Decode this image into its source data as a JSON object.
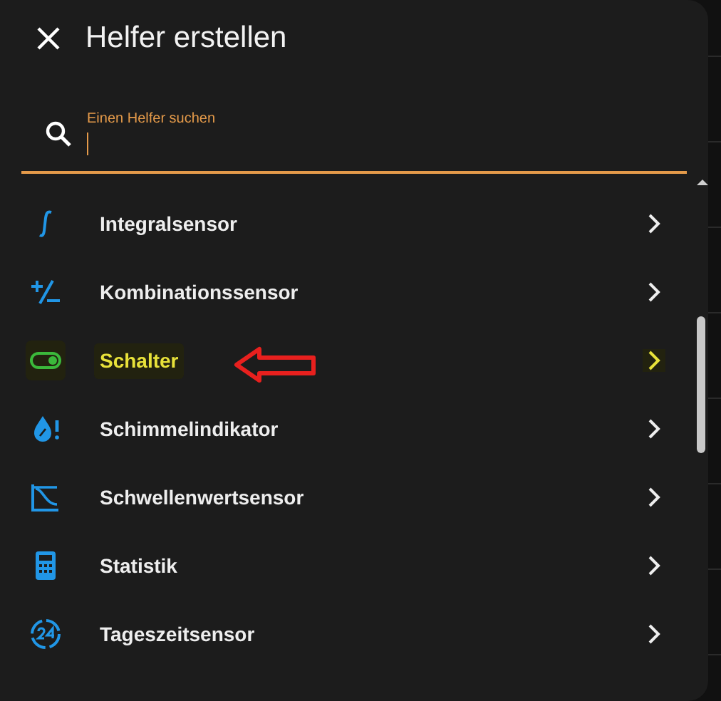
{
  "dialog": {
    "title": "Helfer erstellen",
    "search": {
      "label": "Einen Helfer suchen",
      "focused": true
    },
    "items": [
      {
        "kind": "integral",
        "label": "Integralsensor",
        "highlighted": false
      },
      {
        "kind": "plusminus",
        "label": "Kombinationssensor",
        "highlighted": false
      },
      {
        "kind": "toggle",
        "label": "Schalter",
        "highlighted": true
      },
      {
        "kind": "mold",
        "label": "Schimmelindikator",
        "highlighted": false
      },
      {
        "kind": "threshold",
        "label": "Schwellenwertsensor",
        "highlighted": false
      },
      {
        "kind": "calculator",
        "label": "Statistik",
        "highlighted": false
      },
      {
        "kind": "clock24",
        "label": "Tageszeitsensor",
        "highlighted": false
      }
    ]
  }
}
